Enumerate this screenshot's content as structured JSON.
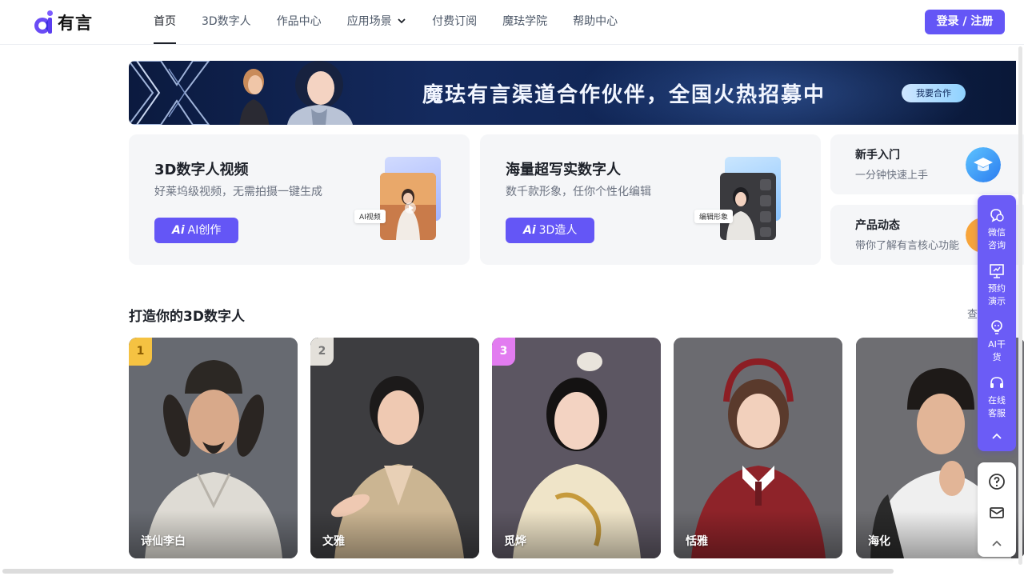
{
  "header": {
    "logo_text": "有言",
    "nav": [
      {
        "label": "首页",
        "active": true
      },
      {
        "label": "3D数字人"
      },
      {
        "label": "作品中心"
      },
      {
        "label": "应用场景",
        "has_dropdown": true
      },
      {
        "label": "付费订阅"
      },
      {
        "label": "魔珐学院"
      },
      {
        "label": "帮助中心"
      }
    ],
    "login_label": "登录 / 注册"
  },
  "banner": {
    "title": "魔珐有言渠道合作伙伴，全国火热招募中",
    "button_label": "我要合作"
  },
  "features": [
    {
      "title": "3D数字人视频",
      "subtitle": "好莱坞级视频，无需拍摄一键生成",
      "button_ai": "Ai",
      "button_label": "AI创作",
      "tag": "AI视频"
    },
    {
      "title": "海量超写实数字人",
      "subtitle": "数千款形象，任你个性化编辑",
      "button_ai": "Ai",
      "button_label": "3D造人",
      "tag": "编辑形象"
    }
  ],
  "mini_cards": [
    {
      "title": "新手入门",
      "subtitle": "一分钟快速上手"
    },
    {
      "title": "产品动态",
      "subtitle": "带你了解有言核心功能"
    }
  ],
  "section": {
    "title": "打造你的3D数字人",
    "more_label": "查看更多"
  },
  "avatars": [
    {
      "rank": "1",
      "name": "诗仙李白"
    },
    {
      "rank": "2",
      "name": "文雅"
    },
    {
      "rank": "3",
      "name": "觅烨"
    },
    {
      "rank": "",
      "name": "恬雅"
    },
    {
      "rank": "",
      "name": "海化"
    }
  ],
  "side_panel": {
    "items": [
      {
        "label": "微信咨询",
        "icon": "wechat-chat-icon"
      },
      {
        "label": "预约演示",
        "icon": "presentation-icon"
      },
      {
        "label": "AI干货",
        "icon": "lightbulb-icon"
      },
      {
        "label": "在线客服",
        "icon": "headset-icon"
      }
    ],
    "collapse_icon": "chevron-up-icon",
    "bottom_icons": [
      "help-icon",
      "mail-icon",
      "back-to-top-icon"
    ]
  },
  "colors": {
    "accent": "#6456f6",
    "banner_bg": "#0e2350",
    "card_bg": "#f5f6f8",
    "rank1": "#f5c242",
    "rank2": "#e3e0da",
    "rank3": "#e27cf0"
  }
}
